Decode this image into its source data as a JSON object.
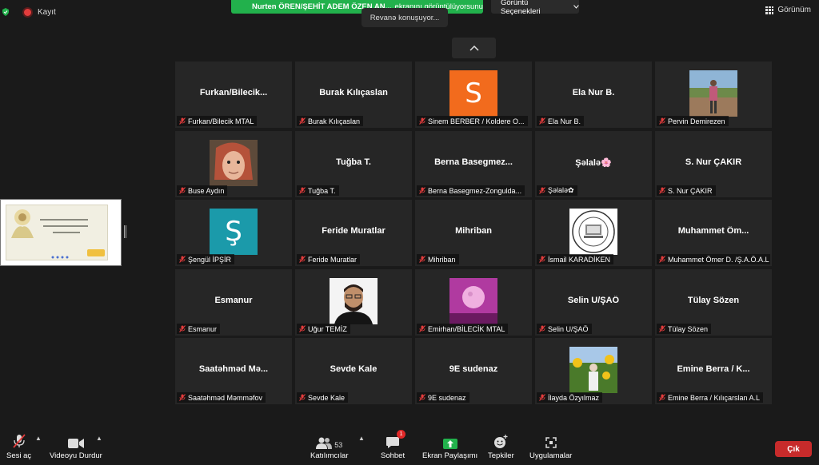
{
  "top": {
    "record_label": "Kayıt",
    "banner_presenter": "Nurten ÖREN/ŞEHİT ADEM ÖZEN AN...",
    "banner_suffix": "ekranını görüntülüyorsunuz",
    "view_options": "Görüntü Seçenekleri",
    "speaking": "Revanə konuşuyor...",
    "layout": "Görünüm"
  },
  "tiles": [
    {
      "big": "Furkan/Bilecik...",
      "label": "Furkan/Bilecik MTAL",
      "avatar": null
    },
    {
      "big": "Burak Kılıçaslan",
      "label": "Burak Kılıçaslan",
      "avatar": null
    },
    {
      "big": "",
      "label": "Sinem BERBER / Koldere O...",
      "avatar": {
        "type": "letter",
        "letter": "S",
        "color": "#f26b1d"
      }
    },
    {
      "big": "Ela Nur B.",
      "label": "Ela Nur B.",
      "avatar": null
    },
    {
      "big": "",
      "label": "Pervin Demirezen",
      "avatar": {
        "type": "photo",
        "icon": "person-outdoor-photo"
      }
    },
    {
      "big": "",
      "label": "Buse Aydın",
      "avatar": {
        "type": "photo",
        "icon": "cartoon-character-photo"
      }
    },
    {
      "big": "Tuğba T.",
      "label": "Tuğba T.",
      "avatar": null
    },
    {
      "big": "Berna Basegmez...",
      "label": "Berna Basegmez-Zongulda...",
      "avatar": null
    },
    {
      "big": "Şəlalə🌸",
      "label": "Şəlalə✿",
      "avatar": null
    },
    {
      "big": "S. Nur ÇAKIR",
      "label": "S. Nur ÇAKIR",
      "avatar": null
    },
    {
      "big": "",
      "label": "Şengül İPŞİR",
      "avatar": {
        "type": "letter",
        "letter": "Ş",
        "color": "#1b9aaa"
      }
    },
    {
      "big": "Feride Muratlar",
      "label": "Feride Muratlar",
      "avatar": null
    },
    {
      "big": "Mihriban",
      "label": "Mihriban",
      "avatar": null
    },
    {
      "big": "",
      "label": "İsmail KARADİKEN",
      "avatar": {
        "type": "photo",
        "icon": "school-logo"
      }
    },
    {
      "big": "Muhammet Öm...",
      "label": "Muhammet Ömer D. /Ş.A.Ö.A.L",
      "avatar": null
    },
    {
      "big": "Esmanur",
      "label": "Esmanur",
      "avatar": null
    },
    {
      "big": "",
      "label": "Uğur TEMİZ",
      "avatar": {
        "type": "photo",
        "icon": "man-portrait-photo"
      }
    },
    {
      "big": "",
      "label": "Emirhan/BİLECİK MTAL",
      "avatar": {
        "type": "photo",
        "icon": "pink-moon-photo"
      }
    },
    {
      "big": "Selin U/ŞAÖ",
      "label": "Selin U/ŞAÖ",
      "avatar": null
    },
    {
      "big": "Tülay Sözen",
      "label": "Tülay Sözen",
      "avatar": null
    },
    {
      "big": "Saatəhməd Mə...",
      "label": "Saatəhməd Məmməfov",
      "avatar": null
    },
    {
      "big": "Sevde Kale",
      "label": "Sevde Kale",
      "avatar": null
    },
    {
      "big": "9E sudenaz",
      "label": "9E sudenaz",
      "avatar": null
    },
    {
      "big": "",
      "label": "İlayda Özyılmaz",
      "avatar": {
        "type": "photo",
        "icon": "sunflower-field-photo"
      }
    },
    {
      "big": "Emine Berra / K...",
      "label": "Emine Berra / Kılıçarslan A.L",
      "avatar": null
    }
  ],
  "toolbar": {
    "mute": "Sesi aç",
    "video": "Videoyu Durdur",
    "participants": "Katılımcılar",
    "participants_count": "53",
    "chat": "Sohbet",
    "chat_badge": "1",
    "share": "Ekran Paylaşımı",
    "reactions": "Tepkiler",
    "apps": "Uygulamalar",
    "leave": "Çık"
  },
  "colors": {
    "share_green": "#22b14c",
    "leave_red": "#c72b2b",
    "mic_off_red": "#e23c3c"
  }
}
